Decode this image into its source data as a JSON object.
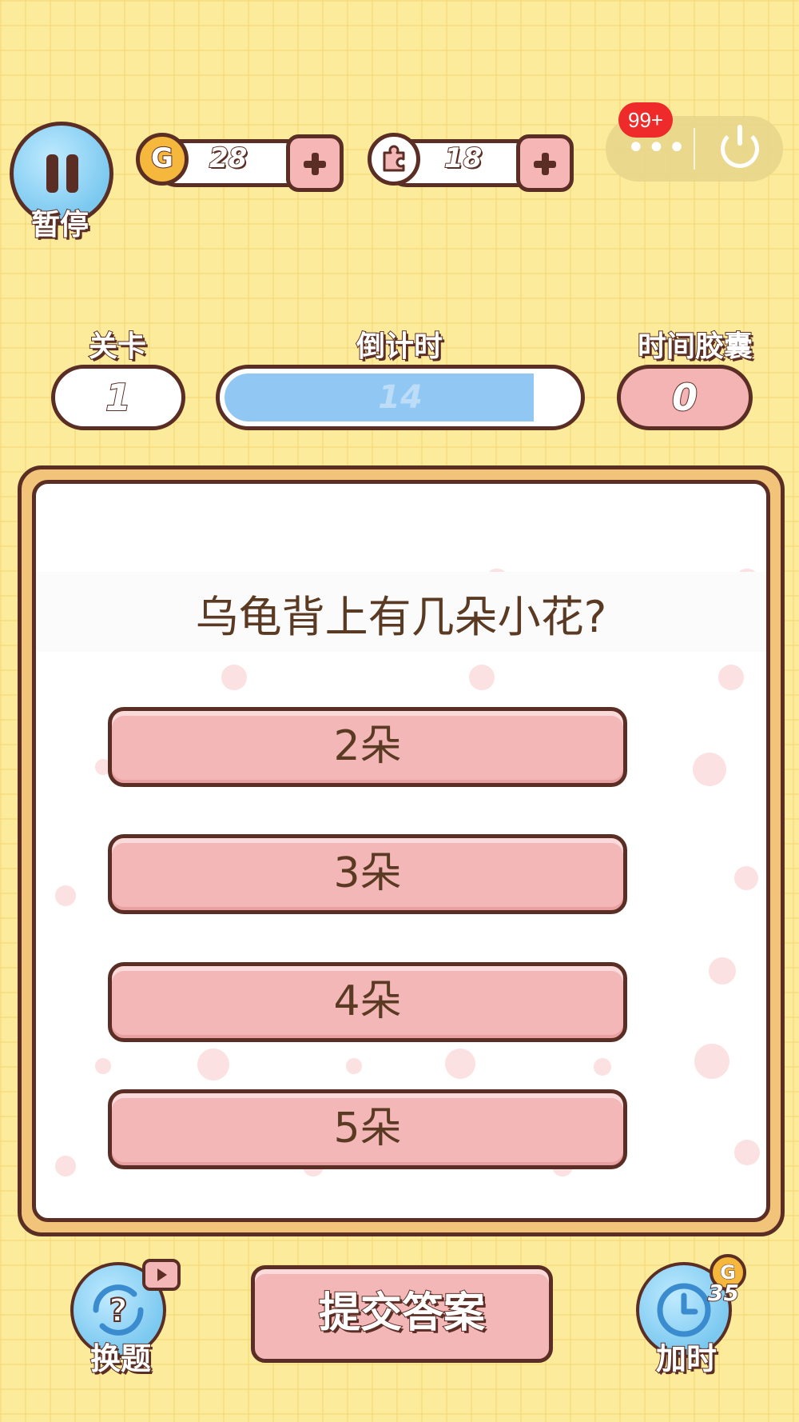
{
  "header": {
    "pause_label": "暂停",
    "coins": {
      "value": "28",
      "icon": "coin-icon",
      "icon_letter": "G"
    },
    "puzzle": {
      "value": "18",
      "icon": "puzzle-piece-icon"
    },
    "notification_badge": "99+",
    "more_glyph": "•••"
  },
  "stats": {
    "level_label": "关卡",
    "level_value": "1",
    "timer_label": "倒计时",
    "timer_value": "14",
    "timer_progress": 0.88,
    "capsule_label": "时间胶囊",
    "capsule_value": "0"
  },
  "question": {
    "text": "乌龟背上有几朵小花?",
    "options": [
      "2朵",
      "3朵",
      "4朵",
      "5朵"
    ]
  },
  "footer": {
    "change_label": "换题",
    "submit_label": "提交答案",
    "add_time_label": "加时",
    "add_time_cost": "35",
    "add_time_cost_icon_letter": "G"
  },
  "colors": {
    "background": "#fbeb9a",
    "outline": "#5a2e25",
    "option_fill": "#f4b7b7",
    "timer_fill": "#91c8f3",
    "panel_frame": "#f2c47a",
    "badge_red": "#ee2a2a"
  }
}
